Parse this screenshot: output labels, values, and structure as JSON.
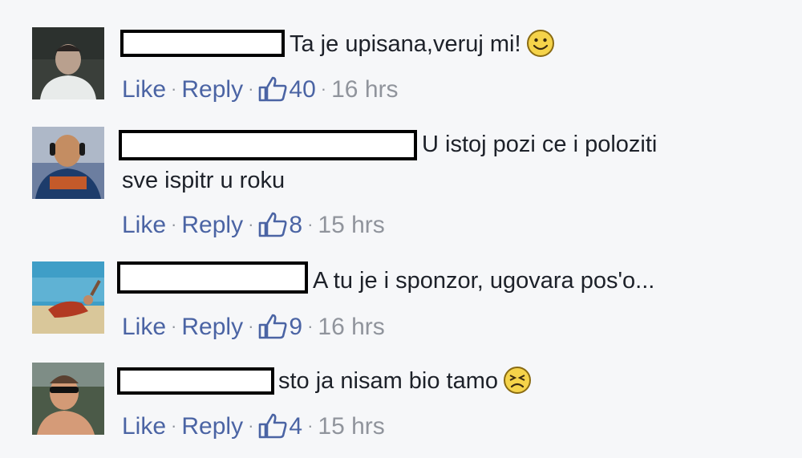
{
  "actions": {
    "like": "Like",
    "reply": "Reply",
    "sep": "·"
  },
  "comments": [
    {
      "text": "Ta je upisana,veruj mi!",
      "emoji": "smile-emoji",
      "likes": "40",
      "time": "16 hrs"
    },
    {
      "text_line1": "U istoj pozi ce i poloziti",
      "text_line2": "sve ispitr u roku",
      "likes": "8",
      "time": "15 hrs"
    },
    {
      "text": "A tu je i sponzor, ugovara pos'o...",
      "likes": "9",
      "time": "16 hrs"
    },
    {
      "text": "sto ja nisam bio tamo",
      "emoji": "persevere-emoji",
      "likes": "4",
      "time": "15 hrs"
    }
  ],
  "colors": {
    "link": "#4b64a4",
    "meta": "#90949c",
    "text": "#1d2129",
    "background": "#f6f7f9"
  }
}
